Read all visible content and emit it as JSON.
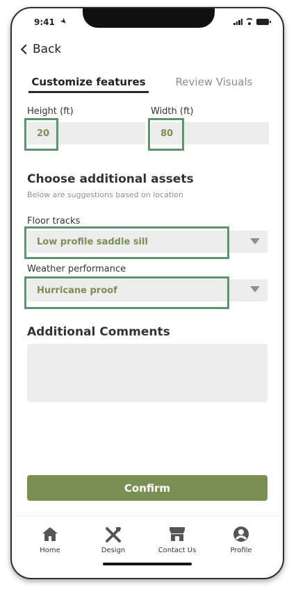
{
  "status_bar": {
    "time": "9:41"
  },
  "back": {
    "label": "Back"
  },
  "tabs": [
    {
      "label": "Customize features",
      "active": true
    },
    {
      "label": "Review Visuals",
      "active": false
    }
  ],
  "dimensions": {
    "height": {
      "label": "Height (ft)",
      "value": "20"
    },
    "width": {
      "label": "Width (ft)",
      "value": "80"
    }
  },
  "assets": {
    "title": "Choose additional assets",
    "subtitle": "Below are suggestions based on location",
    "floor_tracks": {
      "label": "Floor tracks",
      "value": "Low profile saddle sill"
    },
    "weather": {
      "label": "Weather performance",
      "value": "Hurricane proof"
    }
  },
  "comments": {
    "title": "Additional Comments",
    "value": ""
  },
  "confirm_label": "Confirm",
  "nav": [
    {
      "label": "Home",
      "icon": "home-icon"
    },
    {
      "label": "Design",
      "icon": "design-icon"
    },
    {
      "label": "Contact Us",
      "icon": "store-icon"
    },
    {
      "label": "Profile",
      "icon": "profile-icon"
    }
  ],
  "colors": {
    "accent": "#7b8f55",
    "highlight": "#5f9270",
    "field_bg": "#ececec"
  }
}
